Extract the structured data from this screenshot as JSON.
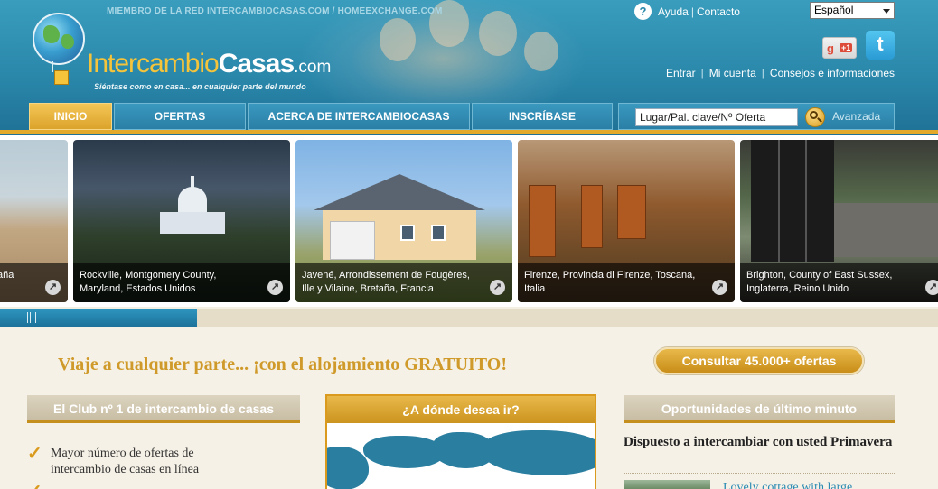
{
  "header": {
    "network_text": "MIEMBRO DE LA RED INTERCAMBIOCASAS.COM / HOMEEXCHANGE.COM",
    "logo_part1": "Intercambio",
    "logo_part2": "Casas",
    "logo_part3": ".com",
    "tagline": "Siéntase como en casa... en cualquier parte del mundo",
    "help_label": "Ayuda",
    "contact_label": "Contacto",
    "language": "Español",
    "gplus_label": "+1",
    "account_links": [
      "Entrar",
      "Mi cuenta",
      "Consejos e informaciones"
    ]
  },
  "nav": {
    "items": [
      "INICIO",
      "OFERTAS",
      "ACERCA DE INTERCAMBIOCASAS",
      "INSCRÍBASE"
    ],
    "active": "INICIO",
    "search_placeholder": "Lugar/Pal. clave/Nº Oferta",
    "advanced_label": "Avanzada"
  },
  "carousel": {
    "slides": [
      {
        "caption": "aña"
      },
      {
        "caption": "Rockville, Montgomery County, Maryland, Estados Unidos"
      },
      {
        "caption": "Javené, Arrondissement de Fougères, Ille y Vilaine, Bretaña, Francia"
      },
      {
        "caption": "Firenze, Provincia di Firenze, Toscana, Italia"
      },
      {
        "caption": "Brighton, County of East Sussex, Inglaterra, Reino Unido"
      }
    ],
    "progress_fraction": 0.21
  },
  "main": {
    "promo": "Viaje a cualquier parte... ¡con el alojamiento GRATUITO!",
    "cta": "Consultar 45.000+ ofertas",
    "club_heading": "El Club nº 1 de intercambio de casas",
    "club_item_1": "Mayor número de ofertas de intercambio de casas en línea",
    "map_heading": "¿A dónde desea ir?",
    "last_minute_heading": "Oportunidades de último minuto",
    "last_minute_title": "Dispuesto a intercambiar con usted Primavera",
    "last_minute_link": "Lovely cottage with large"
  },
  "colors": {
    "header_blue": "#2a88ab",
    "accent_gold": "#d99a1d",
    "link_blue": "#2a8ab3"
  }
}
